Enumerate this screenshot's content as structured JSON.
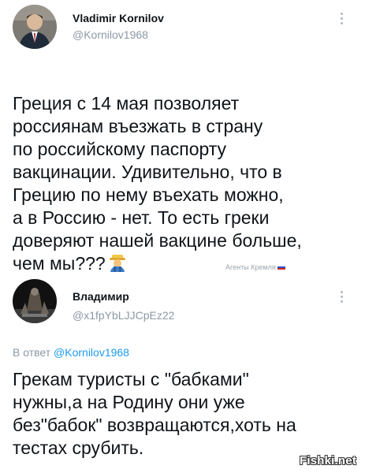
{
  "tweet1": {
    "author": "Vladimir Kornilov",
    "handle": "@Kornilov1968",
    "text": "Греция с 14 мая позволяет\nроссиянам въезжать в страну\nпо российскому паспорту\nвакцинации. Удивительно, что в\nГрецию по нему въехать можно,\nа в Россию - нет. То есть греки\nдоверяют нашей вакцине больше,\nчем мы???",
    "emoji_icon": "farmer-emoji-icon"
  },
  "watermark": {
    "text": "Агенты Кремля"
  },
  "tweet2": {
    "author": "Владимир",
    "handle": "@x1fpYbLJJCpEz22",
    "reply_prefix": "В ответ ",
    "reply_mention": "@Kornilov1968",
    "text": "Грекам туристы с \"бабками\"\nнужны,а на Родину они уже\nбез\"бабок\" возвращаются,хоть на\nтестах срубить."
  },
  "site_watermark": "Fishki.net",
  "colors": {
    "handle": "#8b98a5",
    "mention": "#1d9bf0",
    "text": "#0f1419"
  }
}
